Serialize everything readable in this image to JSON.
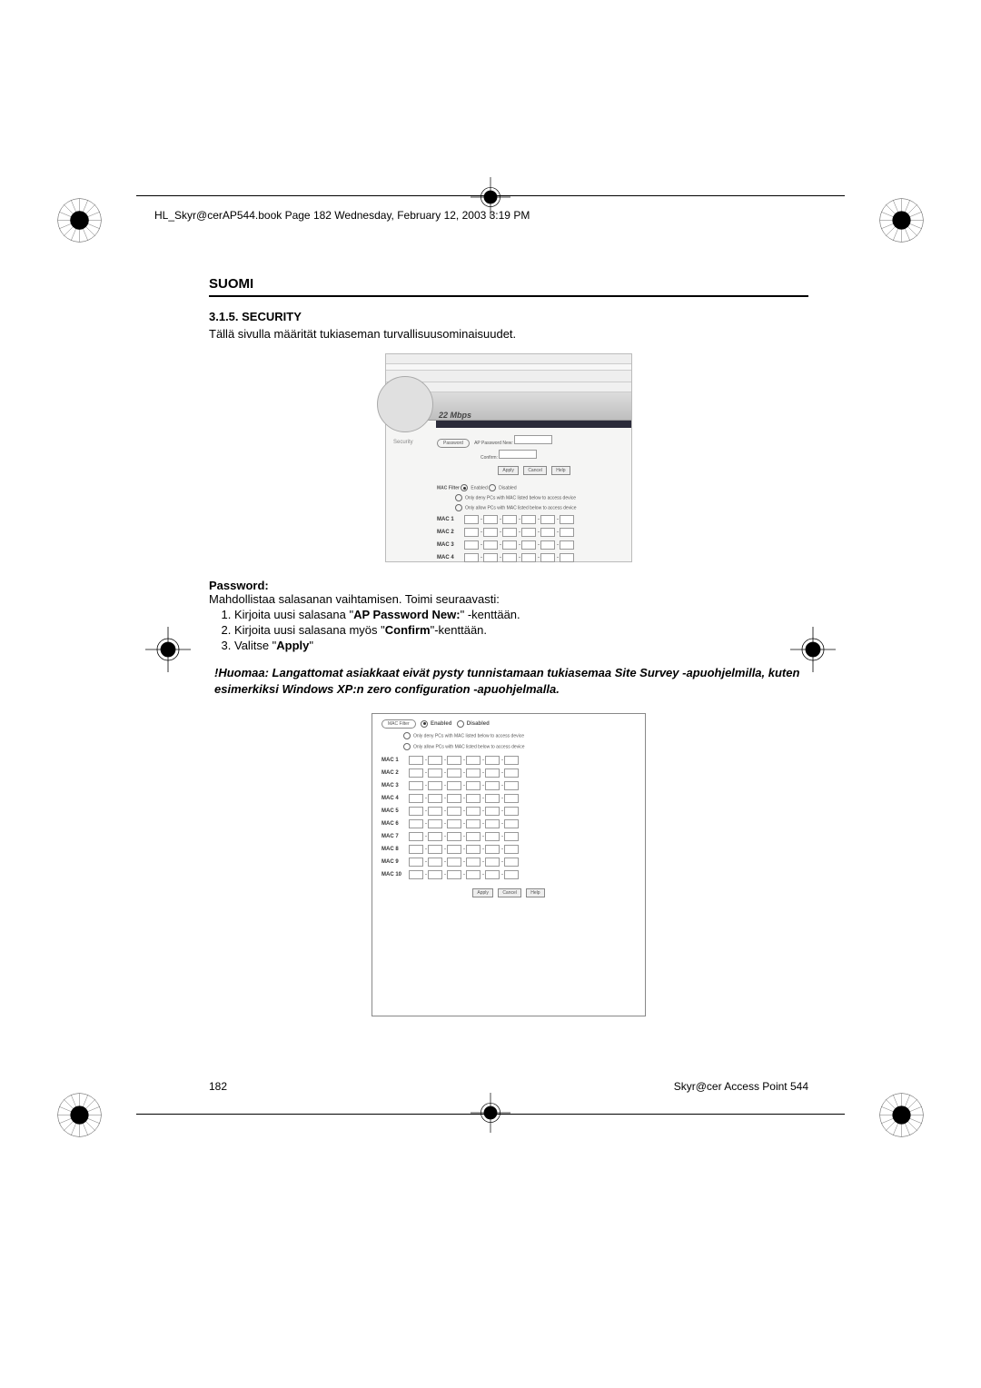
{
  "header_line": "HL_Skyr@cerAP544.book  Page 182  Wednesday, February 12, 2003  3:19 PM",
  "lang_label": "SUOMI",
  "section_title": "3.1.5. SECURITY",
  "intro": "Tällä sivulla määrität tukiaseman turvallisuusominaisuudet.",
  "screenshot1": {
    "brand": "22 Mbps",
    "sidebar_label": "Security",
    "password_pill": "Password",
    "ap_pw_label": "AP Password New:",
    "confirm_label": "Confirm:",
    "btn_apply": "Apply",
    "btn_cancel": "Cancel",
    "btn_help": "Help",
    "macfilter_label": "MAC Filter",
    "enabled": "Enabled",
    "disabled": "Disabled",
    "deny_text": "Only deny PCs with MAC listed below to access device",
    "allow_text": "Only allow PCs with MAC listed below to access device",
    "rows": [
      "MAC 1",
      "MAC 2",
      "MAC 3",
      "MAC 4"
    ]
  },
  "password_heading": "Password:",
  "password_line": "Mahdollistaa salasanan vaihtamisen. Toimi seuraavasti:",
  "steps": [
    {
      "pre": "Kirjoita uusi salasana \"",
      "bold": "AP Password New:",
      "post": "\" -kenttään."
    },
    {
      "pre": "Kirjoita uusi salasana myös \"",
      "bold": "Confirm",
      "post": "\"-kenttään."
    },
    {
      "pre": "Valitse \"",
      "bold": "Apply",
      "post": "\""
    }
  ],
  "note": "!Huomaa: Langattomat asiakkaat eivät pysty tunnistamaan tukiasemaa Site Survey  -apuohjelmilla, kuten esimerkiksi Windows XP:n zero configuration  -apuohjelmalla.",
  "screenshot2": {
    "macfilter_label": "MAC Filter",
    "enabled": "Enabled",
    "disabled": "Disabled",
    "deny_text": "Only deny PCs with MAC listed below to access device",
    "allow_text": "Only allow PCs with MAC listed below to access device",
    "rows": [
      "MAC 1",
      "MAC 2",
      "MAC 3",
      "MAC 4",
      "MAC 5",
      "MAC 6",
      "MAC 7",
      "MAC 8",
      "MAC 9",
      "MAC 10"
    ],
    "btn_apply": "Apply",
    "btn_cancel": "Cancel",
    "btn_help": "Help"
  },
  "footer_page": "182",
  "footer_product": "Skyr@cer Access Point 544"
}
